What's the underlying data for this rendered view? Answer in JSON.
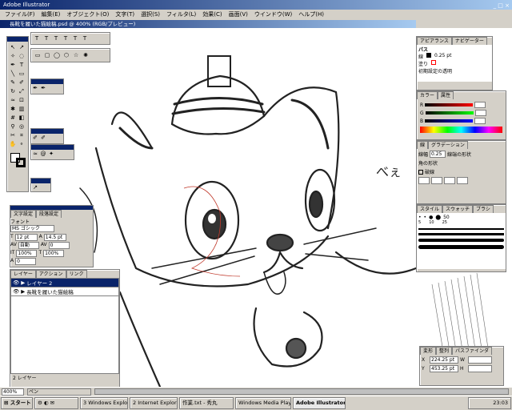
{
  "app": {
    "title": "Adobe Illustrator"
  },
  "menu": [
    "ファイル(F)",
    "編集(E)",
    "オブジェクト(O)",
    "文字(T)",
    "選択(S)",
    "フィルタ(L)",
    "効果(C)",
    "画面(V)",
    "ウインドウ(W)",
    "ヘルプ(H)"
  ],
  "document": {
    "title": "長靴を履いた猫絵稿.psd @ 400% (RGB/プレビュー)"
  },
  "canvas": {
    "annotation": "べぇ"
  },
  "appearance": {
    "tab_label": "アピアランス",
    "tab2_label": "ナビゲーター",
    "path_label": "パス",
    "stroke_label": "線",
    "stroke_value": "0.25 pt",
    "fill_label": "塗り",
    "default_label": "初期設定の透明"
  },
  "color": {
    "tab_label": "カラー",
    "tab2_label": "属性",
    "channels": [
      "R",
      "G",
      "B"
    ]
  },
  "stroke": {
    "tab_label": "線",
    "tab2_label": "グラデーション",
    "weight_label": "線幅",
    "weight_value": "0.25",
    "cap_label": "線端の形状",
    "join_label": "角の形状",
    "dash_label": "破線"
  },
  "brushes": {
    "tab_label": "スタイル",
    "tab2_label": "スウォッチ",
    "tab3_label": "ブラシ",
    "size_value": "50",
    "sizes": [
      "5",
      "10",
      "25"
    ]
  },
  "character": {
    "tab_label": "文字設定",
    "tab2_label": "段落設定",
    "font_label": "フォント",
    "font_value": "MS ゴシック",
    "size_value": "12 pt",
    "leading_value": "14.5 pt",
    "tracking_value": "自動",
    "kerning_value": "0",
    "hscale_value": "100%",
    "vscale_value": "100%",
    "baseline_value": "0"
  },
  "layers": {
    "tab_label": "レイヤー",
    "tab2_label": "アクション",
    "tab3_label": "リンク",
    "rows": [
      {
        "name": "レイヤー 2",
        "selected": true
      },
      {
        "name": "長靴を履いた猫絵稿",
        "selected": false
      }
    ],
    "count_label": "2 レイヤー"
  },
  "transform": {
    "tab_label": "変形",
    "tab2_label": "整列",
    "tab3_label": "パスファインダ",
    "x_label": "X",
    "x_value": "224.25 pt",
    "y_label": "Y",
    "y_value": "453.25 pt",
    "w_label": "W",
    "h_label": "H"
  },
  "status": {
    "zoom": "400%",
    "info": "ペン"
  },
  "taskbar": {
    "start": "スタート",
    "items": [
      "3 Windows Explorer",
      "2 Internet Explorer",
      "作業.txt - 秀丸",
      "Windows Media Player",
      "Adobe Illustrator"
    ],
    "clock": "23:03"
  },
  "colors": {
    "titlebar": "#0a246a",
    "selected": "#0a246a",
    "canvas": "#ffffff",
    "path": "#c0392b"
  }
}
